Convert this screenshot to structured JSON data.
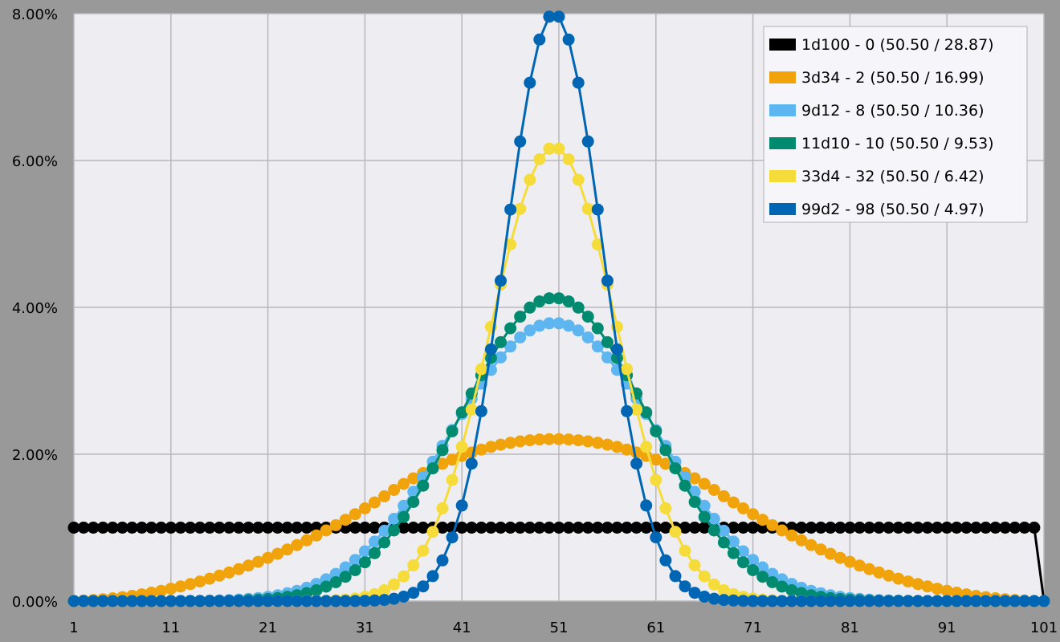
{
  "chart_data": {
    "type": "line",
    "title": "",
    "xlabel": "",
    "ylabel": "",
    "xlim": [
      1,
      101
    ],
    "ylim": [
      0,
      8
    ],
    "x_ticks": [
      "1",
      "11",
      "21",
      "31",
      "41",
      "51",
      "61",
      "71",
      "81",
      "91",
      "101"
    ],
    "y_ticks": [
      "0.00%",
      "2.00%",
      "4.00%",
      "6.00%",
      "8.00%"
    ],
    "grid": true,
    "legend_position": "top-right",
    "series": [
      {
        "name": "1d100 - 0 (50.50 / 28.87)",
        "color": "#000000",
        "mean": 50.5,
        "sd": 28.87,
        "distribution": "uniform 1-100",
        "value_percent": 1.0
      },
      {
        "name": "3d34 - 2 (50.50 / 16.99)",
        "color": "#F0A30A",
        "mean": 50.5,
        "sd": 16.99,
        "peak_percent": 2.2
      },
      {
        "name": "9d12 - 8 (50.50 / 10.36)",
        "color": "#5DB6F0",
        "mean": 50.5,
        "sd": 10.36,
        "peak_percent": 3.78
      },
      {
        "name": "11d10 - 10 (50.50 / 9.53)",
        "color": "#008A70",
        "mean": 50.5,
        "sd": 9.53,
        "peak_percent": 4.15
      },
      {
        "name": "33d4 - 32 (50.50 / 6.42)",
        "color": "#F5DC3A",
        "mean": 50.5,
        "sd": 6.42,
        "peak_percent": 6.18
      },
      {
        "name": "99d2 - 98 (50.50 / 4.97)",
        "color": "#0066B3",
        "mean": 50.5,
        "sd": 4.97,
        "peak_percent": 8.0
      }
    ]
  }
}
